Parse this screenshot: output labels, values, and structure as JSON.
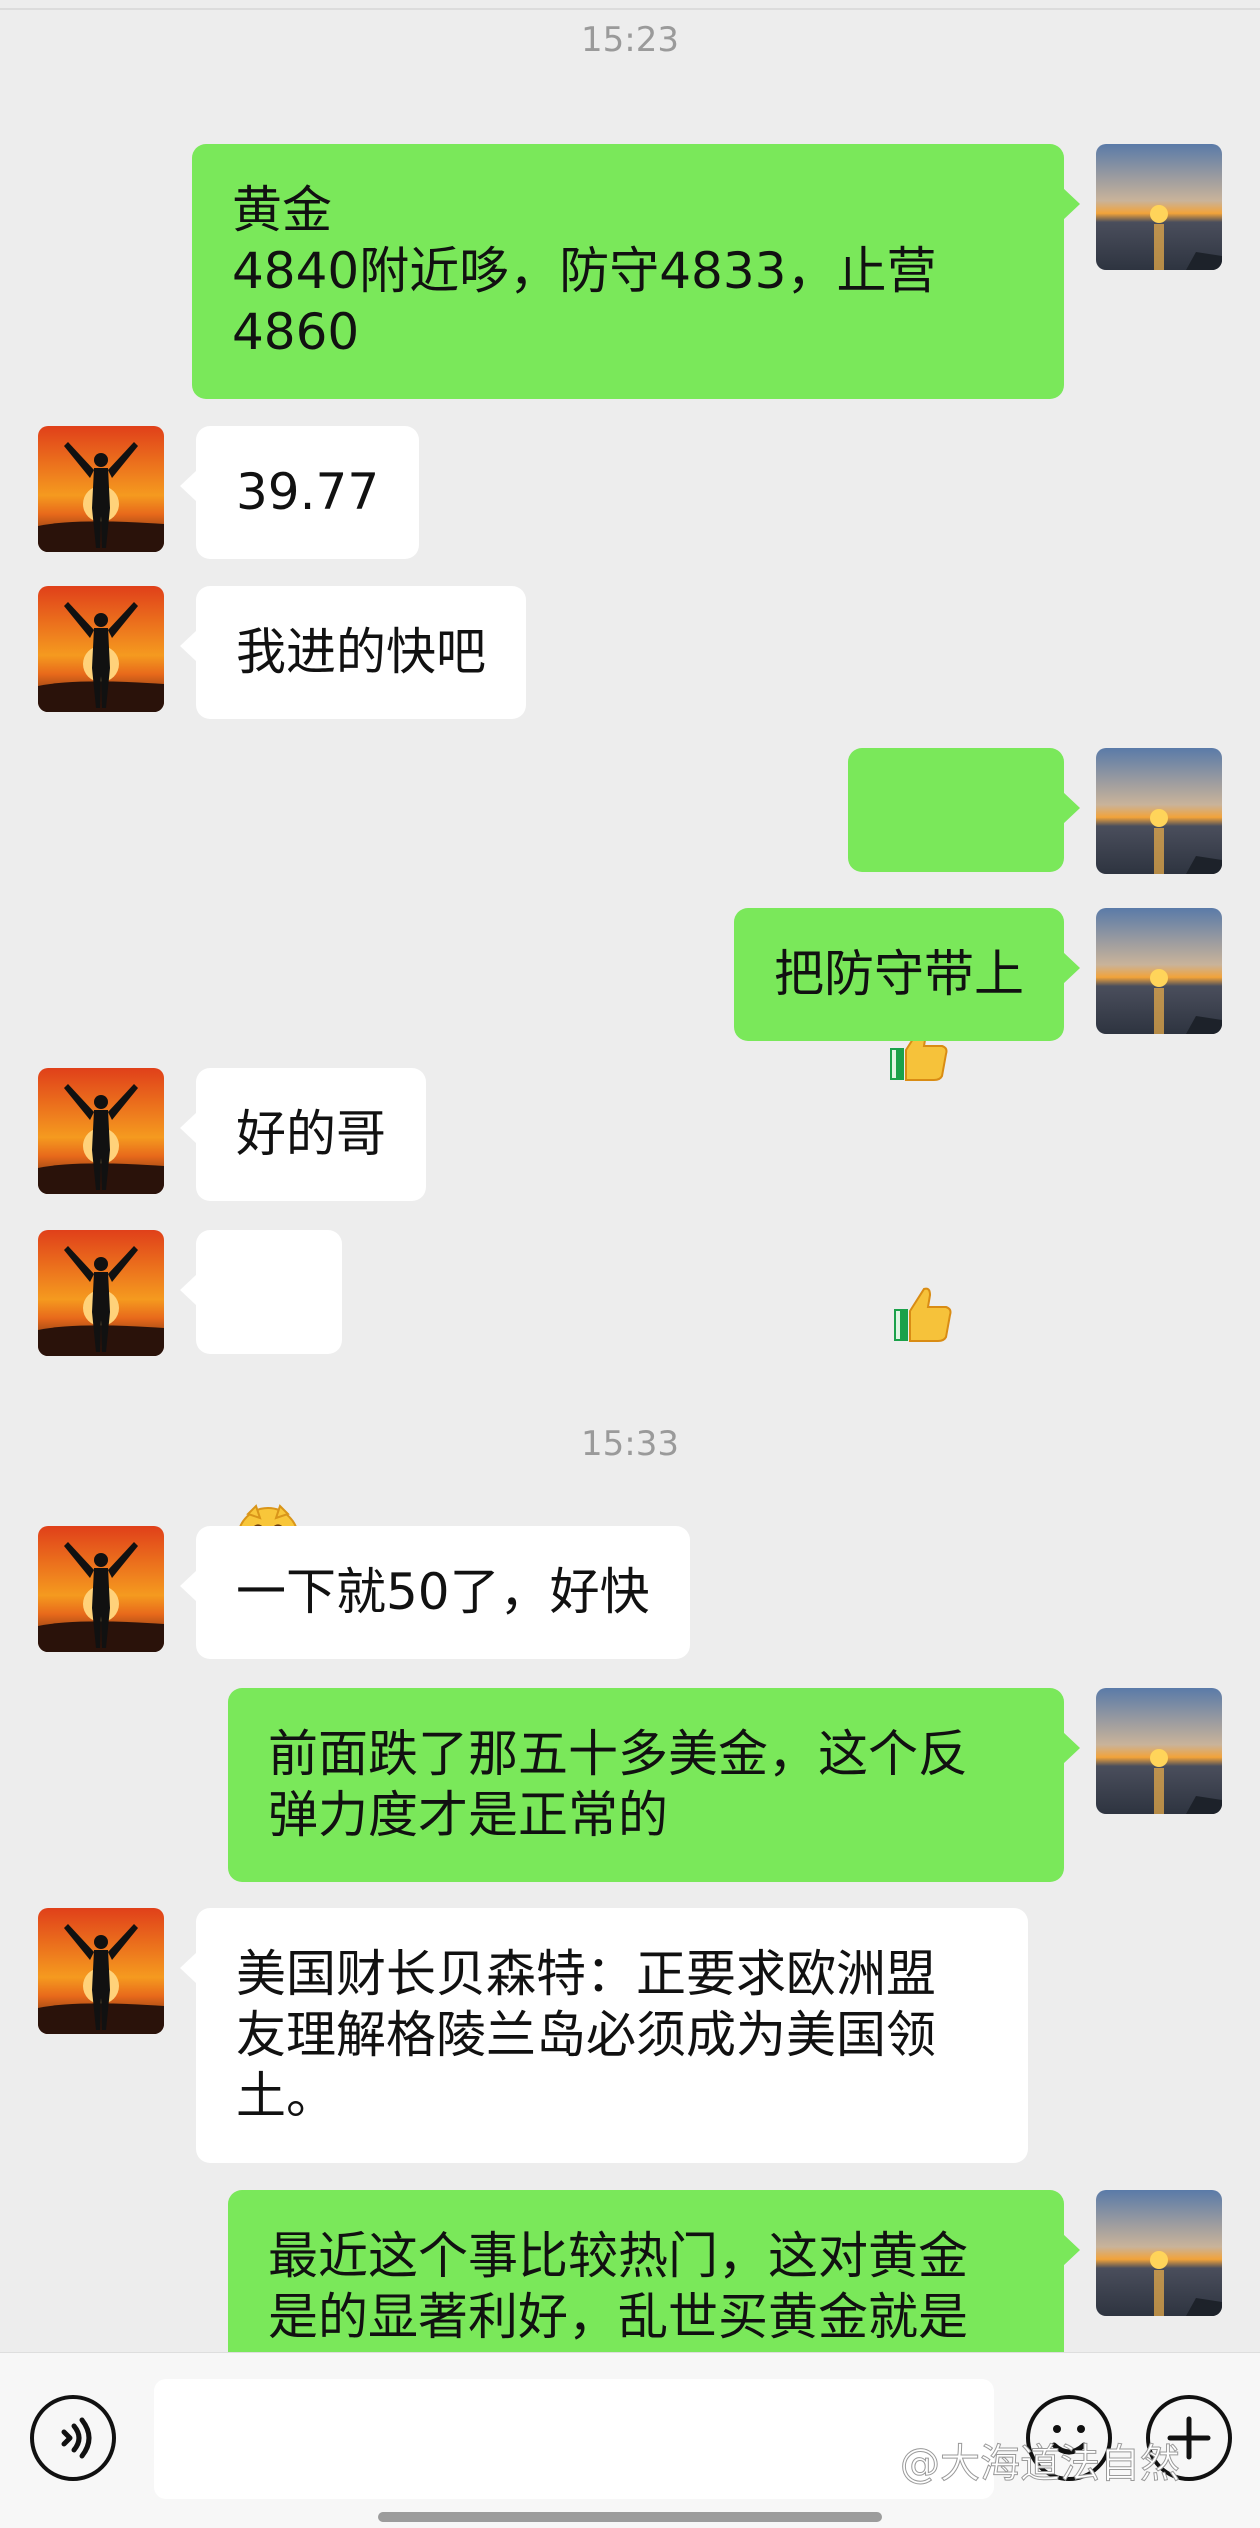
{
  "messages": {
    "time1": "15:23",
    "m1": "黄金\n4840附近哆，防守4833，止营\n4860",
    "m2": "39.77",
    "m3": "我进的快吧",
    "m4_emoji": "thumbs-up thumbs-up",
    "m5": "把防守带上",
    "m6": "好的哥",
    "m7_emoji": "grinning-face",
    "time2": "15:33",
    "m8": "一下就50了，好快",
    "m9": "前面跌了那五十多美金，这个反\n弹力度才是正常的",
    "m10": "美国财长贝森特：正要求欧洲盟\n友理解格陵兰岛必须成为美国领\n土。",
    "m11": "最近这个事比较热门，这对黄金\n是的显著利好，乱世买黄金就是"
  },
  "input": {
    "placeholder": ""
  },
  "watermark": "@大海道法自然",
  "colors": {
    "out_bubble": "#7ae85a",
    "in_bubble": "#ffffff",
    "background": "#ededed"
  },
  "icons": [
    "voice-icon",
    "emoji-icon",
    "plus-icon",
    "thumbs-up-icon",
    "grinning-face-icon",
    "sunset-avatar-icon",
    "silhouette-avatar-icon"
  ]
}
